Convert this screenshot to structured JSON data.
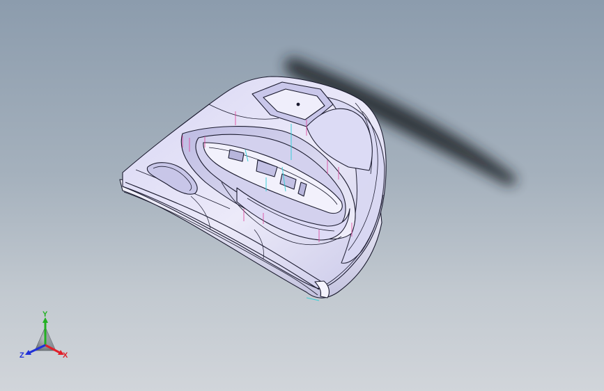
{
  "viewport": {
    "background_top": "#8c9cad",
    "background_bottom": "#d1d5da"
  },
  "model": {
    "body_color": "#e6e5f8",
    "edge_color": "#1a1a2e",
    "shadow_color": "#1e2328",
    "magenta_lines": "#e0409a",
    "cyan_lines": "#2ad0d8"
  },
  "triad": {
    "x_label": "X",
    "y_label": "Y",
    "z_label": "Z",
    "x_color": "#e0202a",
    "y_color": "#22b022",
    "z_color": "#2030d8"
  }
}
